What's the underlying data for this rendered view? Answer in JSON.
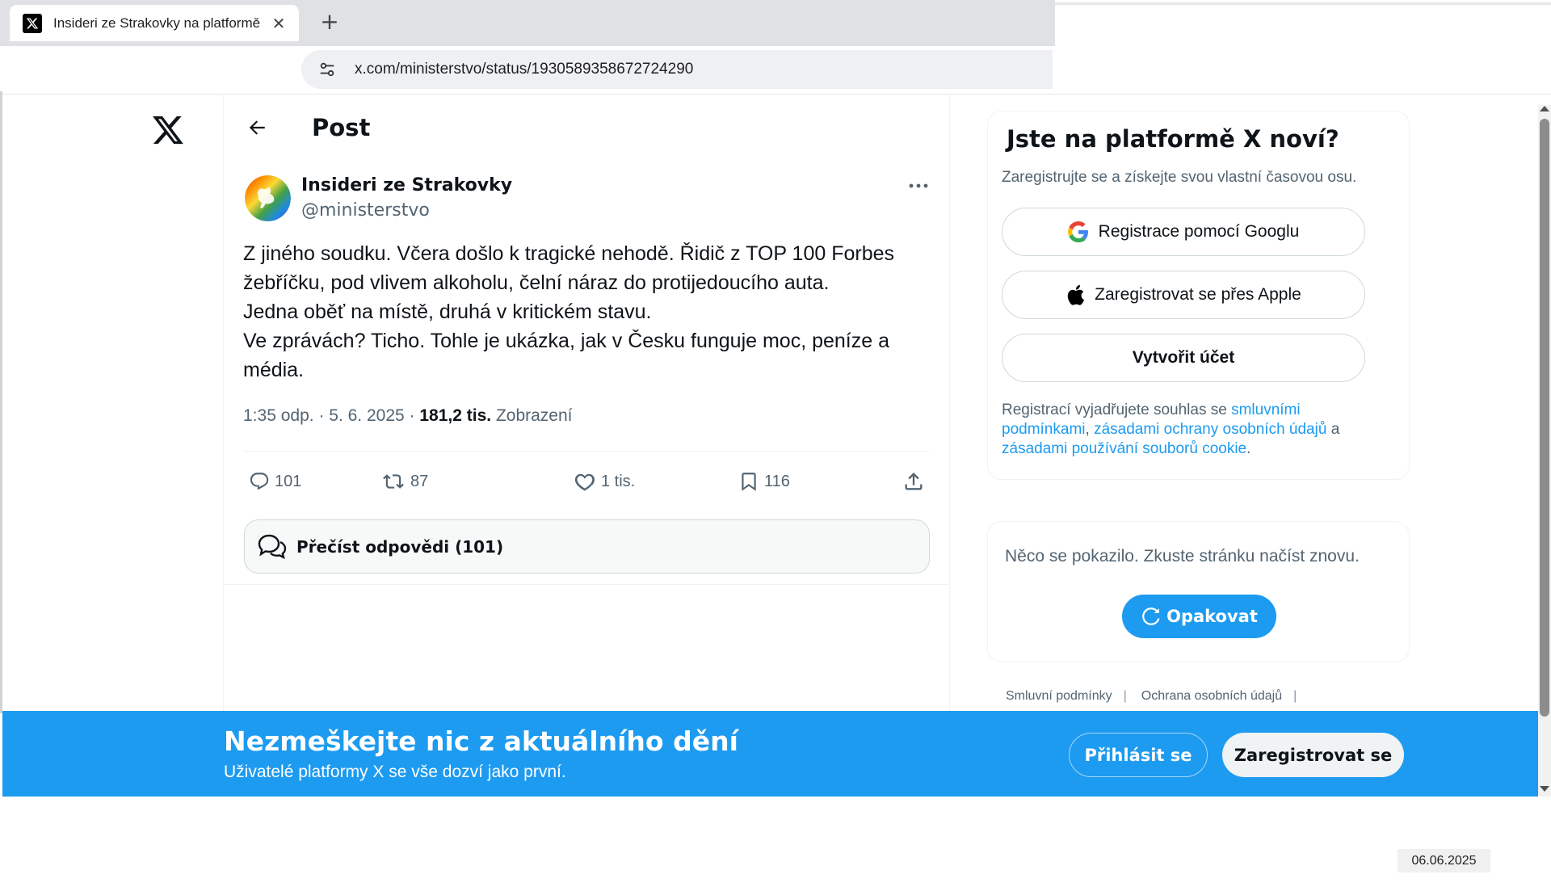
{
  "browser": {
    "tab_title": "Insideri ze Strakovky na platformě X",
    "new_tab_icon": "plus-icon",
    "url": "x.com/ministerstvo/status/1930589358672724290"
  },
  "header": {
    "title": "Post"
  },
  "post": {
    "author_name": "Insideri ze Strakovky",
    "author_handle": "@ministerstvo",
    "text": "Z jiného soudku. Včera došlo k tragické nehodě. Řidič z TOP 100 Forbes\nžebříčku, pod vlivem alkoholu, čelní náraz do protijedoucího auta.\nJedna oběť na místě, druhá v kritickém stavu.\nVe zprávách? Ticho. Tohle je ukázka, jak v Česku funguje moc, peníze a\nmédia.",
    "time": "1:35 odp.",
    "date": "5. 6. 2025",
    "views_count": "181,2 tis.",
    "views_label": "Zobrazení",
    "replies": "101",
    "reposts": "87",
    "likes": "1 tis.",
    "bookmarks": "116",
    "read_replies_label": "Přečíst odpovědi (101)"
  },
  "signup": {
    "title": "Jste na platformě X noví?",
    "subtitle": "Zaregistrujte se a získejte svou vlastní časovou osu.",
    "google_label": "Registrace pomocí Googlu",
    "apple_label": "Zaregistrovat se přes Apple",
    "create_label": "Vytvořit účet",
    "terms_prefix": "Registrací vyjadřujete souhlas se ",
    "terms_link1": "smluvními podmínkami",
    "terms_comma": ", ",
    "terms_link2": "zásadami ochrany osobních údajů",
    "terms_and": " a ",
    "terms_link3": "zásadami používání souborů cookie",
    "terms_end": "."
  },
  "error": {
    "message": "Něco se pokazilo. Zkuste stránku načíst znovu.",
    "retry_label": "Opakovat"
  },
  "footer": {
    "link1": "Smluvní podmínky",
    "link2": "Ochrana osobních údajů",
    "separator": "|"
  },
  "banner": {
    "title": "Nezmeškejte nic z aktuálního dění",
    "subtitle": "Uživatelé platformy X se vše dozví jako první.",
    "login_label": "Přihlásit se",
    "register_label": "Zaregistrovat se"
  },
  "stamp": {
    "date": "06.06.2025"
  },
  "colors": {
    "accent": "#1d9bf0",
    "text": "#0f1419",
    "muted": "#536471"
  }
}
